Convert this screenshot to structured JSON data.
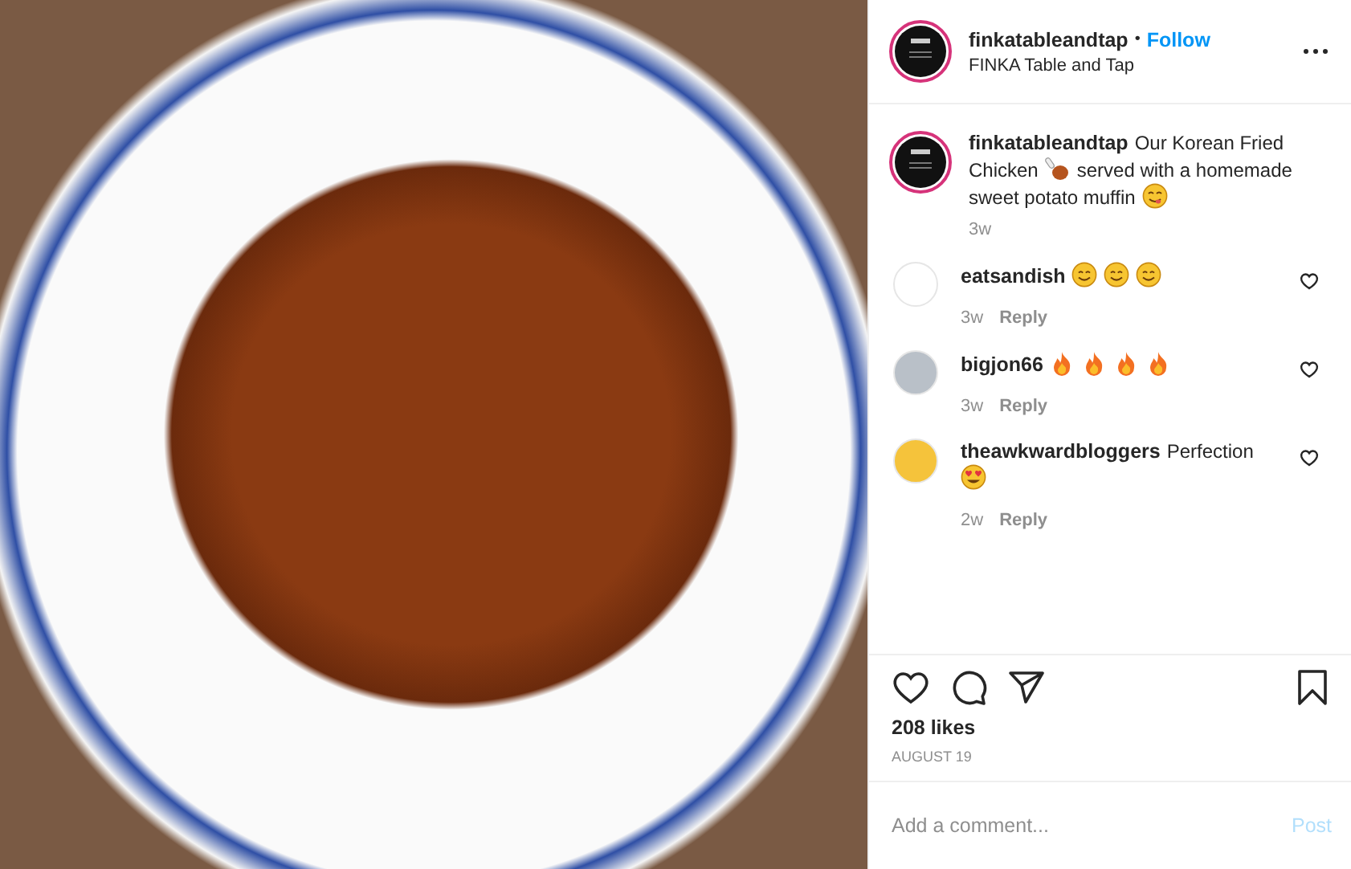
{
  "header": {
    "username": "finkatableandtap",
    "separator": "•",
    "follow": "Follow",
    "subtitle": "FINKA Table and Tap"
  },
  "caption": {
    "username": "finkatableandtap",
    "parts": [
      {
        "kind": "text",
        "text": "Our Korean Fried"
      },
      {
        "kind": "text",
        "text": "Chicken"
      },
      {
        "kind": "drumstick"
      },
      {
        "kind": "text",
        "text": "served with a homemade"
      },
      {
        "kind": "text",
        "text": "sweet potato muffin"
      },
      {
        "kind": "yum"
      }
    ],
    "time": "3w"
  },
  "comments": [
    {
      "username": "eatsandish",
      "color": "#ffffff",
      "parts": [
        {
          "kind": "smile"
        },
        {
          "kind": "smile"
        },
        {
          "kind": "smile"
        }
      ],
      "time": "3w",
      "reply": "Reply",
      "liked": false
    },
    {
      "username": "bigjon66",
      "color": "#b9c0c8",
      "parts": [
        {
          "kind": "fire"
        },
        {
          "kind": "fire"
        },
        {
          "kind": "fire"
        },
        {
          "kind": "fire"
        }
      ],
      "time": "3w",
      "reply": "Reply",
      "liked": false
    },
    {
      "username": "theawkwardbloggers",
      "color": "#f5c33b",
      "parts": [
        {
          "kind": "text",
          "text": "Perfection"
        },
        {
          "kind": "heart-eyes"
        }
      ],
      "time": "2w",
      "reply": "Reply",
      "liked": false
    }
  ],
  "actions": {
    "liked": false,
    "saved": false
  },
  "likes": "208 likes",
  "date": "AUGUST 19",
  "comment_box": {
    "placeholder": "Add a comment...",
    "post": "Post",
    "disabled": true
  }
}
